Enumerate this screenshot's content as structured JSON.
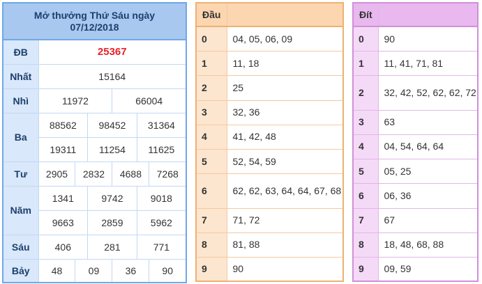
{
  "prize_table": {
    "title_line1": "Mở thưởng Thứ Sáu ngày",
    "title_line2": "07/12/2018",
    "db": {
      "label": "ĐB",
      "values": [
        "25367"
      ]
    },
    "nhat": {
      "label": "Nhất",
      "values": [
        "15164"
      ]
    },
    "nhi": {
      "label": "Nhì",
      "values": [
        "11972",
        "66004"
      ]
    },
    "ba": {
      "label": "Ba",
      "values": [
        "88562",
        "98452",
        "31364",
        "19311",
        "11254",
        "11625"
      ]
    },
    "tu": {
      "label": "Tư",
      "values": [
        "2905",
        "2832",
        "4688",
        "7268"
      ]
    },
    "nam": {
      "label": "Năm",
      "values": [
        "1341",
        "9742",
        "9018",
        "9663",
        "2859",
        "5962"
      ]
    },
    "sau": {
      "label": "Sáu",
      "values": [
        "406",
        "281",
        "771"
      ]
    },
    "bay": {
      "label": "Bảy",
      "values": [
        "48",
        "09",
        "36",
        "90"
      ]
    }
  },
  "dau_table": {
    "header": "Đầu",
    "rows": [
      {
        "key": "0",
        "values": "04, 05, 06, 09"
      },
      {
        "key": "1",
        "values": "11, 18"
      },
      {
        "key": "2",
        "values": "25"
      },
      {
        "key": "3",
        "values": "32, 36"
      },
      {
        "key": "4",
        "values": "41, 42, 48"
      },
      {
        "key": "5",
        "values": "52, 54, 59"
      },
      {
        "key": "6",
        "values": "62, 62, 63, 64, 64, 67, 68"
      },
      {
        "key": "7",
        "values": "71, 72"
      },
      {
        "key": "8",
        "values": "81, 88"
      },
      {
        "key": "9",
        "values": "90"
      }
    ]
  },
  "dit_table": {
    "header": "Đít",
    "rows": [
      {
        "key": "0",
        "values": "90"
      },
      {
        "key": "1",
        "values": "11, 41, 71, 81"
      },
      {
        "key": "2",
        "values": "32, 42, 52, 62, 62, 72"
      },
      {
        "key": "3",
        "values": "63"
      },
      {
        "key": "4",
        "values": "04, 54, 64, 64"
      },
      {
        "key": "5",
        "values": "05, 25"
      },
      {
        "key": "6",
        "values": "06, 36"
      },
      {
        "key": "7",
        "values": "67"
      },
      {
        "key": "8",
        "values": "18, 48, 68, 88"
      },
      {
        "key": "9",
        "values": "09, 59"
      }
    ]
  },
  "colors": {
    "prize_header_bg": "#a8c8f0",
    "prize_border": "#6fa8e6",
    "special_prize_text": "#e8222a",
    "dau_header_bg": "#fbd6b0",
    "dau_border": "#f0b070",
    "dit_header_bg": "#e8b8ee",
    "dit_border": "#d090d8"
  }
}
